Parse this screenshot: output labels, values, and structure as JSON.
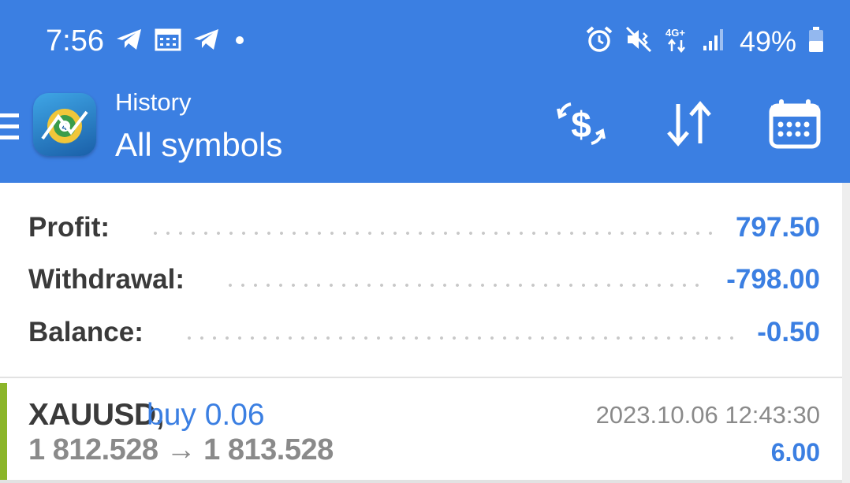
{
  "status_bar": {
    "time": "7:56",
    "left_icons": [
      "telegram-icon",
      "calendar-notification-icon",
      "telegram-icon",
      "dot-icon"
    ],
    "right_icons": [
      "alarm-icon",
      "mute-vibrate-icon",
      "4g-icon",
      "signal-icon"
    ],
    "network_label": "4G+",
    "battery_percent": "49%"
  },
  "toolbar": {
    "subtitle": "History",
    "title": "All symbols",
    "actions": [
      "deposit-filter-icon",
      "sort-icon",
      "calendar-icon"
    ]
  },
  "summary": {
    "rows": [
      {
        "label": "Profit:",
        "value": "797.50"
      },
      {
        "label": "Withdrawal:",
        "value": "-798.00"
      },
      {
        "label": "Balance:",
        "value": "-0.50"
      }
    ]
  },
  "trades": [
    {
      "symbol": "XAUUSD,",
      "side": "buy 0.06",
      "prices": "1 812.528 → 1 813.528",
      "time": "2023.10.06 12:43:30",
      "profit": "6.00"
    }
  ],
  "colors": {
    "accent": "#3b7fe2",
    "trade_bar": "#8bb52a",
    "label_text": "#3a3a3a",
    "muted_text": "#8a8a8a"
  }
}
